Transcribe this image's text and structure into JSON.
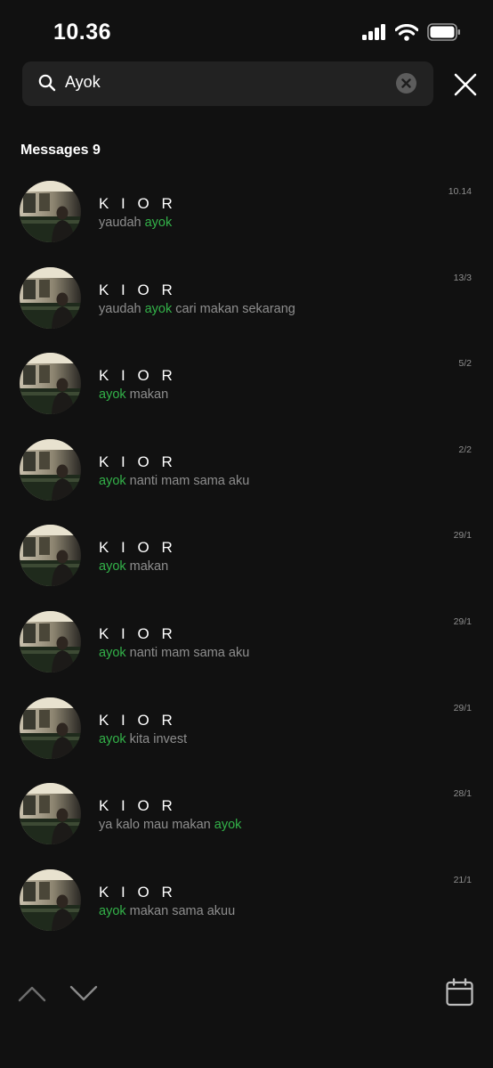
{
  "status_bar": {
    "time": "10.36",
    "icons": [
      "cellular-signal-icon",
      "wifi-icon",
      "battery-icon"
    ]
  },
  "search": {
    "query": "Ayok",
    "icons": [
      "search-icon",
      "clear-icon",
      "close-icon"
    ]
  },
  "results": {
    "section_title": "Messages 9",
    "highlight_color": "#33b249",
    "items": [
      {
        "name": "K I O R",
        "parts": [
          "yaudah ",
          "ayok",
          ""
        ],
        "date": "10.14"
      },
      {
        "name": "K I O R",
        "parts": [
          "yaudah ",
          "ayok",
          " cari makan sekarang"
        ],
        "date": "13/3"
      },
      {
        "name": "K I O R",
        "parts": [
          "",
          "ayok",
          " makan"
        ],
        "date": "5/2"
      },
      {
        "name": "K I O R",
        "parts": [
          "",
          "ayok",
          " nanti mam sama aku"
        ],
        "date": "2/2"
      },
      {
        "name": "K I O R",
        "parts": [
          "",
          "ayok",
          " makan"
        ],
        "date": "29/1"
      },
      {
        "name": "K I O R",
        "parts": [
          "",
          "ayok",
          " nanti mam sama aku"
        ],
        "date": "29/1"
      },
      {
        "name": "K I O R",
        "parts": [
          "",
          "ayok",
          " kita invest"
        ],
        "date": "29/1"
      },
      {
        "name": "K I O R",
        "parts": [
          "ya kalo mau makan ",
          "ayok",
          ""
        ],
        "date": "28/1"
      },
      {
        "name": "K I O R",
        "parts": [
          "",
          "ayok",
          " makan sama akuu"
        ],
        "date": "21/1"
      }
    ]
  },
  "toolbar": {
    "icons": [
      "chevron-up-icon",
      "chevron-down-icon",
      "calendar-icon"
    ]
  }
}
